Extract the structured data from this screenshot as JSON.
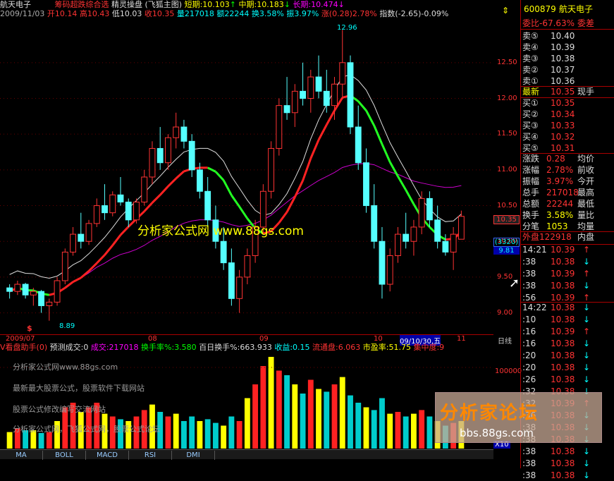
{
  "header": {
    "stock_name": "航天电子",
    "formula": "筹码超跌综合选",
    "tool": "精灵操盘",
    "source": "(飞狐主图)",
    "short": "短期:10.103",
    "mid": "中期:10.183",
    "long": "长期:10.474",
    "date": "2009/11/03",
    "open": "开10.14",
    "high": "高10.43",
    "low": "低10.03",
    "close": "收10.35",
    "vol": "量217018",
    "amt": "额22244",
    "turnover": "换3.58%",
    "amp": "振3.97%",
    "chg": "涨(0.28)2.78%",
    "index": "指数(-2.65)-0.09%"
  },
  "chart": {
    "watermark": "分析家公式网 www.88gs.com",
    "hi_label": "12.96",
    "lo_label": "8.89",
    "cur_price": "10.35",
    "tag1": "(3320)",
    "tag2": "9.81",
    "yticks": [
      {
        "v": 12.5,
        "t": "12.50"
      },
      {
        "v": 12.0,
        "t": "12.00"
      },
      {
        "v": 11.5,
        "t": "11.50"
      },
      {
        "v": 11.0,
        "t": "11.00"
      },
      {
        "v": 10.5,
        "t": "10.50"
      },
      {
        "v": 10.0,
        "t": "10.00"
      },
      {
        "v": 9.5,
        "t": "9.50"
      },
      {
        "v": 9.0,
        "t": "9.00"
      }
    ],
    "ymin": 8.7,
    "ymax": 13.1,
    "xlabels": [
      "2009/07",
      "08",
      "09",
      "10",
      "09/10/30,五",
      "11"
    ],
    "daily": "日线",
    "candles": [
      [
        9.35,
        9.4,
        9.2,
        9.3
      ],
      [
        9.3,
        9.45,
        9.25,
        9.4
      ],
      [
        9.4,
        9.42,
        9.2,
        9.25
      ],
      [
        9.25,
        9.35,
        9.1,
        9.3
      ],
      [
        9.3,
        9.32,
        9.0,
        9.1
      ],
      [
        9.1,
        9.2,
        8.89,
        9.15
      ],
      [
        9.15,
        9.5,
        9.1,
        9.45
      ],
      [
        9.45,
        9.9,
        9.4,
        9.85
      ],
      [
        9.85,
        10.2,
        9.8,
        10.1
      ],
      [
        10.1,
        10.4,
        9.9,
        10.0
      ],
      [
        10.0,
        10.3,
        9.95,
        10.25
      ],
      [
        10.25,
        10.6,
        10.2,
        10.5
      ],
      [
        10.5,
        10.8,
        10.3,
        10.4
      ],
      [
        10.4,
        10.7,
        10.35,
        10.65
      ],
      [
        10.65,
        10.9,
        10.5,
        10.55
      ],
      [
        10.55,
        10.6,
        10.2,
        10.3
      ],
      [
        10.3,
        10.6,
        10.25,
        10.55
      ],
      [
        10.55,
        11.0,
        10.5,
        10.9
      ],
      [
        10.9,
        11.4,
        10.8,
        11.3
      ],
      [
        11.3,
        11.6,
        11.0,
        11.1
      ],
      [
        11.1,
        11.5,
        11.0,
        11.45
      ],
      [
        11.45,
        11.8,
        11.3,
        11.6
      ],
      [
        11.6,
        11.7,
        11.3,
        11.4
      ],
      [
        11.4,
        11.5,
        10.9,
        11.0
      ],
      [
        11.0,
        11.1,
        10.6,
        10.7
      ],
      [
        10.7,
        10.9,
        10.2,
        10.3
      ],
      [
        10.3,
        10.5,
        9.9,
        10.0
      ],
      [
        10.0,
        10.2,
        9.6,
        9.7
      ],
      [
        9.7,
        9.9,
        9.1,
        9.2
      ],
      [
        9.2,
        9.6,
        9.0,
        9.5
      ],
      [
        9.5,
        9.9,
        9.4,
        9.8
      ],
      [
        9.8,
        10.3,
        9.7,
        10.2
      ],
      [
        10.2,
        10.8,
        10.1,
        10.7
      ],
      [
        10.7,
        11.4,
        10.6,
        11.3
      ],
      [
        11.3,
        12.0,
        11.2,
        11.9
      ],
      [
        11.9,
        12.3,
        11.7,
        11.8
      ],
      [
        11.8,
        12.2,
        11.6,
        12.1
      ],
      [
        12.1,
        12.5,
        11.9,
        12.0
      ],
      [
        12.0,
        12.4,
        11.8,
        12.3
      ],
      [
        12.3,
        12.6,
        12.0,
        12.1
      ],
      [
        12.1,
        12.4,
        11.8,
        11.9
      ],
      [
        11.9,
        12.3,
        11.7,
        12.2
      ],
      [
        12.2,
        12.96,
        12.0,
        12.5
      ],
      [
        12.5,
        12.6,
        11.5,
        11.6
      ],
      [
        11.6,
        11.9,
        11.0,
        11.1
      ],
      [
        11.1,
        11.3,
        10.4,
        10.5
      ],
      [
        10.5,
        10.8,
        9.9,
        10.0
      ],
      [
        10.0,
        10.2,
        9.2,
        9.4
      ],
      [
        9.4,
        9.9,
        9.3,
        9.8
      ],
      [
        9.8,
        10.2,
        9.7,
        10.1
      ],
      [
        10.1,
        10.4,
        9.9,
        10.0
      ],
      [
        10.0,
        10.3,
        9.8,
        10.2
      ],
      [
        10.2,
        10.7,
        10.1,
        10.6
      ],
      [
        10.6,
        10.7,
        10.2,
        10.3
      ],
      [
        10.3,
        10.5,
        9.9,
        10.0
      ],
      [
        10.0,
        10.1,
        9.8,
        9.85
      ],
      [
        9.85,
        10.2,
        9.6,
        10.1
      ],
      [
        10.03,
        10.43,
        10.03,
        10.35
      ]
    ],
    "vols": [
      0.18,
      0.22,
      0.2,
      0.2,
      0.17,
      0.18,
      0.3,
      0.45,
      0.5,
      0.4,
      0.45,
      0.5,
      0.38,
      0.35,
      0.32,
      0.3,
      0.35,
      0.42,
      0.48,
      0.4,
      0.35,
      0.38,
      0.3,
      0.35,
      0.3,
      0.32,
      0.28,
      0.25,
      0.35,
      0.3,
      0.55,
      0.7,
      0.9,
      1.0,
      0.85,
      0.8,
      0.7,
      0.6,
      0.75,
      0.65,
      0.62,
      0.7,
      0.78,
      0.58,
      0.5,
      0.45,
      0.42,
      0.55,
      0.38,
      0.4,
      0.35,
      0.38,
      0.42,
      0.35,
      0.3,
      0.25,
      0.28,
      0.3
    ]
  },
  "vol_panel": {
    "name": "V看盘助手(0)",
    "pred": "预测成交:0",
    "deal": "成交:217018",
    "tr": "换手率%:3.580",
    "btr": "百日换手%:663.933",
    "gain": "收益:0.15",
    "float": "流通盘:6.063",
    "pe": "市盈率:51.75",
    "conc": "集中度:9",
    "scale": "100000",
    "wm1": "分析家公式网www.88gs.com",
    "wm2": "最新最大股票公式，股票软件下载网站",
    "wm3": "股票公式修改编写交流网站",
    "wm4": "分析家公式网，飞狐公式网，股票公式论坛",
    "logo": "分析家论坛",
    "logo_url": "bbs.88gs.com",
    "x10": "X10"
  },
  "tabs": [
    "MA",
    "BOLL",
    "MACD",
    "RSI",
    "DMI"
  ],
  "quote": {
    "code": "600879",
    "name": "航天电子",
    "wb": "委比-67.63%",
    "wc": "委差",
    "asks": [
      [
        "卖⑤",
        "10.40"
      ],
      [
        "卖④",
        "10.39"
      ],
      [
        "卖③",
        "10.38"
      ],
      [
        "卖②",
        "10.37"
      ],
      [
        "卖①",
        "10.36"
      ]
    ],
    "latest": "最新",
    "latest_v": "10.35",
    "xs": "现手",
    "bids": [
      [
        "买①",
        "10.35"
      ],
      [
        "买②",
        "10.34"
      ],
      [
        "买③",
        "10.33"
      ],
      [
        "买④",
        "10.32"
      ],
      [
        "买⑤",
        "10.31"
      ]
    ],
    "stats": [
      [
        "涨跌",
        "0.28",
        "均价"
      ],
      [
        "涨幅",
        "2.78%",
        "前收"
      ],
      [
        "振幅",
        "3.97%",
        "今开"
      ],
      [
        "总手",
        "217018",
        "最高"
      ],
      [
        "总额",
        "22244",
        "最低"
      ],
      [
        "换手",
        "3.58%",
        "量比"
      ],
      [
        "分笔",
        "1053",
        "均量"
      ]
    ],
    "outer": "外盘122918",
    "inner": "内盘",
    "ticks1": [
      [
        "14:21",
        "10.39",
        "↑"
      ],
      [
        ":38",
        "10.38",
        "↓"
      ],
      [
        ":38",
        "10.39",
        "↑"
      ],
      [
        ":38",
        "10.38",
        "↓"
      ],
      [
        ":56",
        "10.39",
        "↑"
      ]
    ],
    "ticks2": [
      [
        "14:22",
        "10.38",
        "↓"
      ],
      [
        ":10",
        "10.38",
        "↓"
      ],
      [
        ":16",
        "10.39",
        "↑"
      ],
      [
        ":16",
        "10.38",
        "↓"
      ],
      [
        ":20",
        "10.38",
        "↓"
      ],
      [
        ":20",
        "10.38",
        "↓"
      ],
      [
        ":26",
        "10.38",
        "↓"
      ],
      [
        ":32",
        "10.38",
        "↓"
      ],
      [
        ":32",
        "10.39",
        "↑"
      ],
      [
        ":36",
        "10.38",
        "↓"
      ],
      [
        ":38",
        "10.38",
        "↓"
      ],
      [
        ":38",
        "10.38",
        "↓"
      ],
      [
        ":38",
        "10.38",
        "↓"
      ],
      [
        ":38",
        "10.38",
        "↓"
      ],
      [
        ":38",
        "10.38",
        "↓"
      ]
    ]
  }
}
